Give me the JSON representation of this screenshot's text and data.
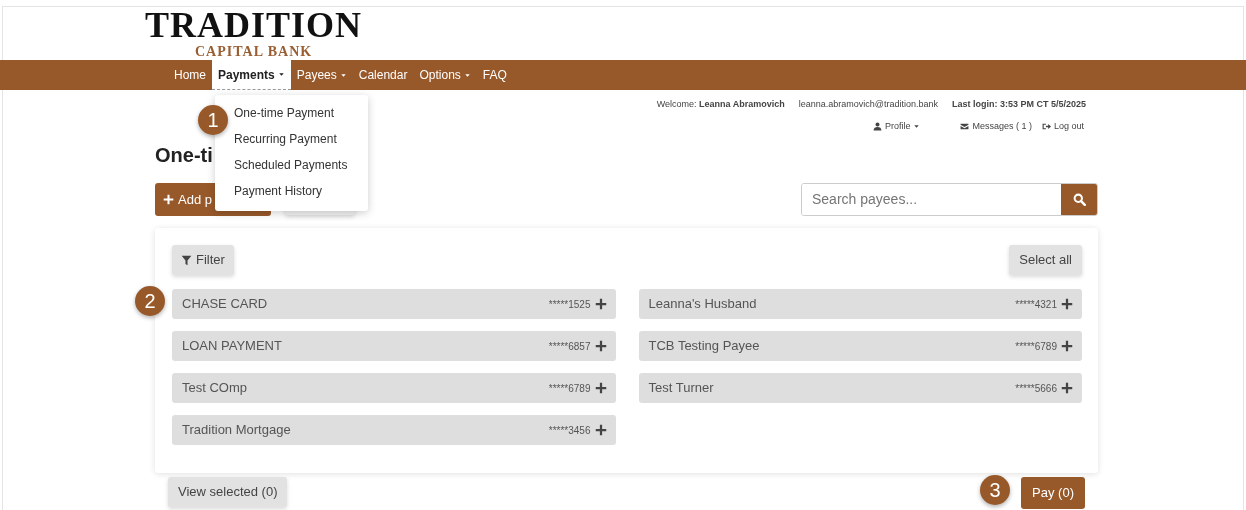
{
  "logo": {
    "name": "TRADITION",
    "tagline": "CAPITAL BANK"
  },
  "nav": [
    {
      "label": "Home",
      "selected": false,
      "dropdown": false
    },
    {
      "label": "Payments",
      "selected": true,
      "dropdown": true
    },
    {
      "label": "Payees",
      "selected": false,
      "dropdown": true
    },
    {
      "label": "Calendar",
      "selected": false,
      "dropdown": false
    },
    {
      "label": "Options",
      "selected": false,
      "dropdown": true
    },
    {
      "label": "FAQ",
      "selected": false,
      "dropdown": false
    }
  ],
  "dropdown_menu": [
    "One-time Payment",
    "Recurring Payment",
    "Scheduled Payments",
    "Payment History"
  ],
  "user_bar": {
    "welcome_label": "Welcome:",
    "user_name": "Leanna Abramovich",
    "email": "leanna.abramovich@tradition.bank",
    "last_login": "Last login: 3:53 PM CT 5/5/2025",
    "profile": "Profile",
    "messages": "Messages ( 1 )",
    "logout": "Log out"
  },
  "page_title": "One-ti",
  "add_button": "Add p",
  "search": {
    "placeholder": "Search payees..."
  },
  "filter_button": "Filter",
  "select_all_button": "Select all",
  "payees": [
    [
      {
        "name": "CHASE CARD",
        "account": "*****1525"
      },
      {
        "name": "LOAN PAYMENT",
        "account": "*****6857"
      },
      {
        "name": "Test COmp",
        "account": "*****6789"
      },
      {
        "name": "Tradition Mortgage",
        "account": "*****3456"
      }
    ],
    [
      {
        "name": "Leanna's Husband",
        "account": "*****4321"
      },
      {
        "name": "TCB Testing Payee",
        "account": "*****6789"
      },
      {
        "name": "Test Turner",
        "account": "*****5666"
      }
    ]
  ],
  "view_selected_button": "View selected (0)",
  "pay_button": "Pay (0)",
  "callouts": [
    "1",
    "2",
    "3"
  ]
}
